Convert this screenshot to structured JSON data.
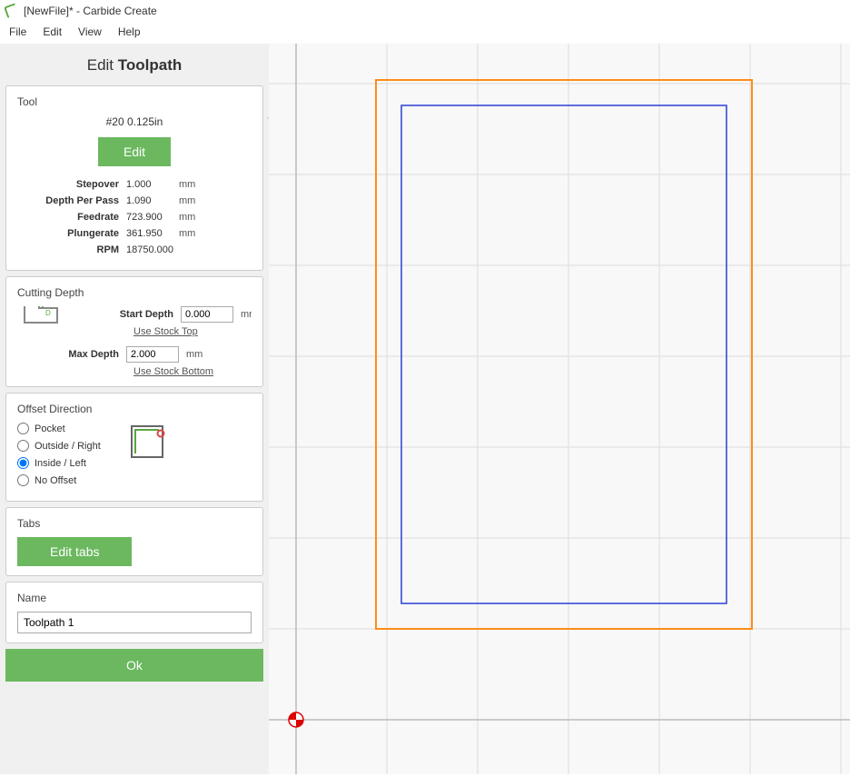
{
  "window": {
    "title": "[NewFile]* - Carbide Create"
  },
  "menu": {
    "file": "File",
    "edit": "Edit",
    "view": "View",
    "help": "Help"
  },
  "page": {
    "title_prefix": "Edit ",
    "title_bold": "Toolpath"
  },
  "tool": {
    "section_label": "Tool",
    "name": "#20 0.125in",
    "edit_btn": "Edit",
    "params": [
      {
        "label": "Stepover",
        "value": "1.000",
        "unit": "mm"
      },
      {
        "label": "Depth Per Pass",
        "value": "1.090",
        "unit": "mm"
      },
      {
        "label": "Feedrate",
        "value": "723.900",
        "unit": "mm"
      },
      {
        "label": "Plungerate",
        "value": "361.950",
        "unit": "mm"
      },
      {
        "label": "RPM",
        "value": "18750.000",
        "unit": ""
      }
    ]
  },
  "depth": {
    "section_label": "Cutting Depth",
    "start_label": "Start Depth",
    "start_value": "0.000",
    "start_unit": "mm",
    "use_top": "Use Stock Top",
    "max_label": "Max Depth",
    "max_value": "2.000",
    "max_unit": "mm",
    "use_bottom": "Use Stock Bottom"
  },
  "offset": {
    "section_label": "Offset Direction",
    "pocket": "Pocket",
    "outside": "Outside / Right",
    "inside": "Inside / Left",
    "none": "No Offset",
    "selected": "inside"
  },
  "tabs": {
    "section_label": "Tabs",
    "btn": "Edit tabs"
  },
  "name": {
    "section_label": "Name",
    "value": "Toolpath 1"
  },
  "ok": "Ok"
}
